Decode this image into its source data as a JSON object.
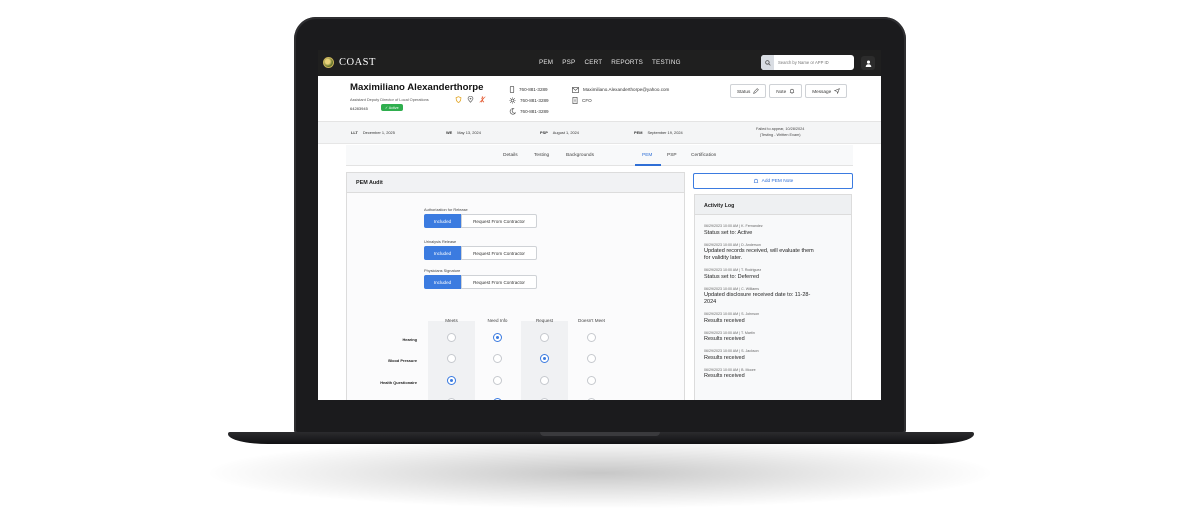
{
  "app": {
    "brand": "COAST",
    "nav": [
      "PEM",
      "PSP",
      "CERT",
      "REPORTS",
      "TESTING"
    ],
    "search_placeholder": "Search by Name or APP ID"
  },
  "profile": {
    "name": "Maximiliano Alexanderthorpe",
    "title": "Assistant Deputy Director of Local Operations",
    "id": "64283945",
    "status_badge": "✓ Active",
    "phones": [
      "760-881-3289",
      "760-881-3289",
      "760-881-3289"
    ],
    "email": "Maximiliano.Alexanderthorpe@yahoo.com",
    "role": "CFO",
    "actions": [
      "Status",
      "Note",
      "Message"
    ]
  },
  "dates": {
    "llt_label": "LLT",
    "llt_value": "December 1, 2025",
    "we_label": "WE",
    "we_value": "May 13, 2024",
    "psp_label": "PSP",
    "psp_value": "August 1, 2024",
    "pem_label": "PEM",
    "pem_value": "September 19, 2024",
    "failed_line1": "Failed to appear, 10/28/2024",
    "failed_line2": "(Testing - Written Exam)"
  },
  "tabs": [
    "Details",
    "Testing",
    "Backgrounds",
    "PEM",
    "PSP",
    "Certification"
  ],
  "audit": {
    "title": "PEM Audit",
    "releases": [
      {
        "label": "Authorization for Release",
        "included": "Included",
        "request": "Request From Contractor"
      },
      {
        "label": "Urinalysis Release",
        "included": "Included",
        "request": "Request From Contractor"
      },
      {
        "label": "Physicians Signature",
        "included": "Included",
        "request": "Request From Contractor"
      }
    ],
    "columns": [
      "Meets",
      "Need Info",
      "Request",
      "Doesn't Meet"
    ],
    "rows": [
      {
        "label": "Hearing",
        "selected": 1
      },
      {
        "label": "Blood Pressure",
        "selected": 2
      },
      {
        "label": "Health Questionaire",
        "selected": 0
      },
      {
        "label": "",
        "selected": 1
      }
    ]
  },
  "add_note_label": "Add PEM Note",
  "log": {
    "title": "Activity Log",
    "entries": [
      {
        "meta": "06/29/2023 10:00 AM  |  K. Fernandez",
        "text": "Status set to: Active"
      },
      {
        "meta": "06/29/2023 10:00 AM  |  D. Anderson",
        "text": "Updated records received, will evaluate them for validity later."
      },
      {
        "meta": "06/29/2023 10:00 AM  |  T. Rodriguez",
        "text": "Status set to: Deferred"
      },
      {
        "meta": "06/29/2023 10:00 AM  |  C. Williams",
        "text": "Updated disclosure received date to: 11-28-2024"
      },
      {
        "meta": "06/29/2023 10:00 AM  |  S. Johnson",
        "text": "Results received"
      },
      {
        "meta": "06/29/2023 10:00 AM  |  T. Martin",
        "text": "Results received"
      },
      {
        "meta": "06/29/2023 10:00 AM  |  S. Jackson",
        "text": "Results received"
      },
      {
        "meta": "06/29/2023 10:00 AM  |  B. Moore",
        "text": "Results received"
      }
    ]
  }
}
